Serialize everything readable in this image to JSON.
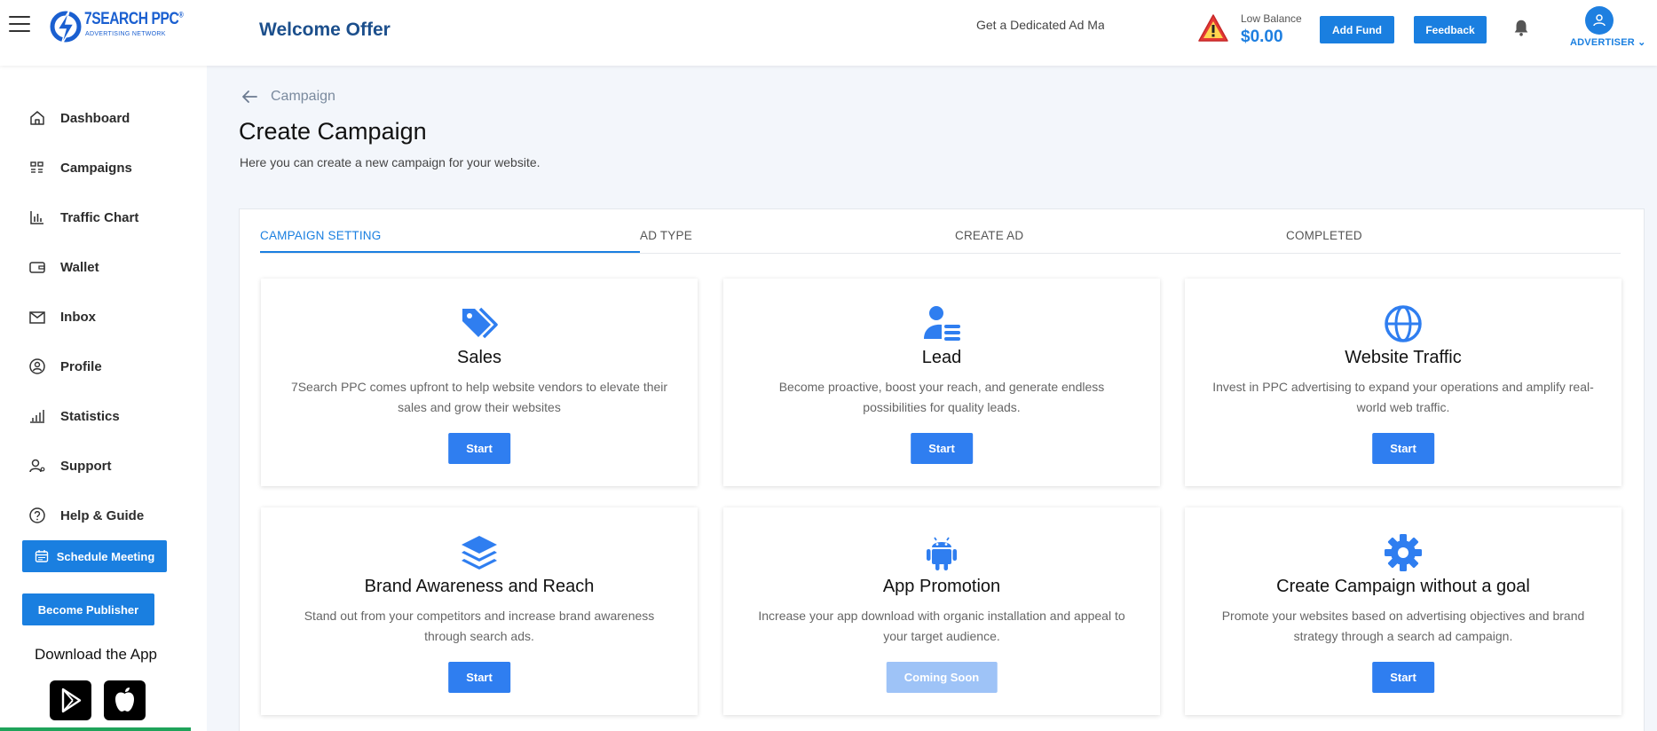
{
  "header": {
    "logo_name": "7SEARCH PPC",
    "logo_registered": "®",
    "logo_sub": "ADVERTISING NETWORK",
    "welcome": "Welcome Offer",
    "marquee_text": "Get a Dedicated Ad Ma",
    "balance_label": "Low Balance",
    "balance_value": "$0.00",
    "add_fund_label": "Add Fund",
    "feedback_label": "Feedback",
    "account_role": "ADVERTISER ⌄"
  },
  "sidebar": {
    "items": [
      {
        "label": "Dashboard",
        "icon": "home-icon"
      },
      {
        "label": "Campaigns",
        "icon": "campaigns-icon"
      },
      {
        "label": "Traffic Chart",
        "icon": "bar-chart-icon"
      },
      {
        "label": "Wallet",
        "icon": "wallet-icon"
      },
      {
        "label": "Inbox",
        "icon": "inbox-icon"
      },
      {
        "label": "Profile",
        "icon": "profile-icon"
      },
      {
        "label": "Statistics",
        "icon": "statistics-icon"
      },
      {
        "label": "Support",
        "icon": "support-icon"
      },
      {
        "label": "Help & Guide",
        "icon": "help-icon"
      }
    ],
    "schedule_label": "Schedule Meeting",
    "publisher_label": "Become Publisher",
    "download_title": "Download the App"
  },
  "main": {
    "breadcrumb": "Campaign",
    "title": "Create Campaign",
    "description": "Here you can create a new campaign for your website.",
    "tabs": [
      {
        "label": "CAMPAIGN SETTING",
        "active": true
      },
      {
        "label": "AD TYPE",
        "active": false
      },
      {
        "label": "CREATE AD",
        "active": false
      },
      {
        "label": "COMPLETED",
        "active": false
      }
    ],
    "cards": [
      {
        "title": "Sales",
        "description": "7Search PPC comes upfront to help website vendors to elevate their sales and grow their websites",
        "button": "Start",
        "icon": "tag-icon"
      },
      {
        "title": "Lead",
        "description": "Become proactive, boost your reach, and generate endless possibilities for quality leads.",
        "button": "Start",
        "icon": "user-list-icon"
      },
      {
        "title": "Website Traffic",
        "description": "Invest in PPC advertising to expand your operations and amplify real-world web traffic.",
        "button": "Start",
        "icon": "globe-icon"
      },
      {
        "title": "Brand Awareness and Reach",
        "description": "Stand out from your competitors and increase brand awareness through search ads.",
        "button": "Start",
        "icon": "layers-icon"
      },
      {
        "title": "App Promotion",
        "description": "Increase your app download with organic installation and appeal to your target audience.",
        "button": "Coming Soon",
        "icon": "android-icon"
      },
      {
        "title": "Create Campaign without a goal",
        "description": "Promote your websites based on advertising objectives and brand strategy through a search ad campaign.",
        "button": "Start",
        "icon": "gear-icon"
      }
    ]
  },
  "colors": {
    "accent": "#1a7fe0",
    "card_button": "#2f7ef0",
    "disabled_button": "#9ec3f7",
    "title_blue": "#1c4f8c"
  }
}
